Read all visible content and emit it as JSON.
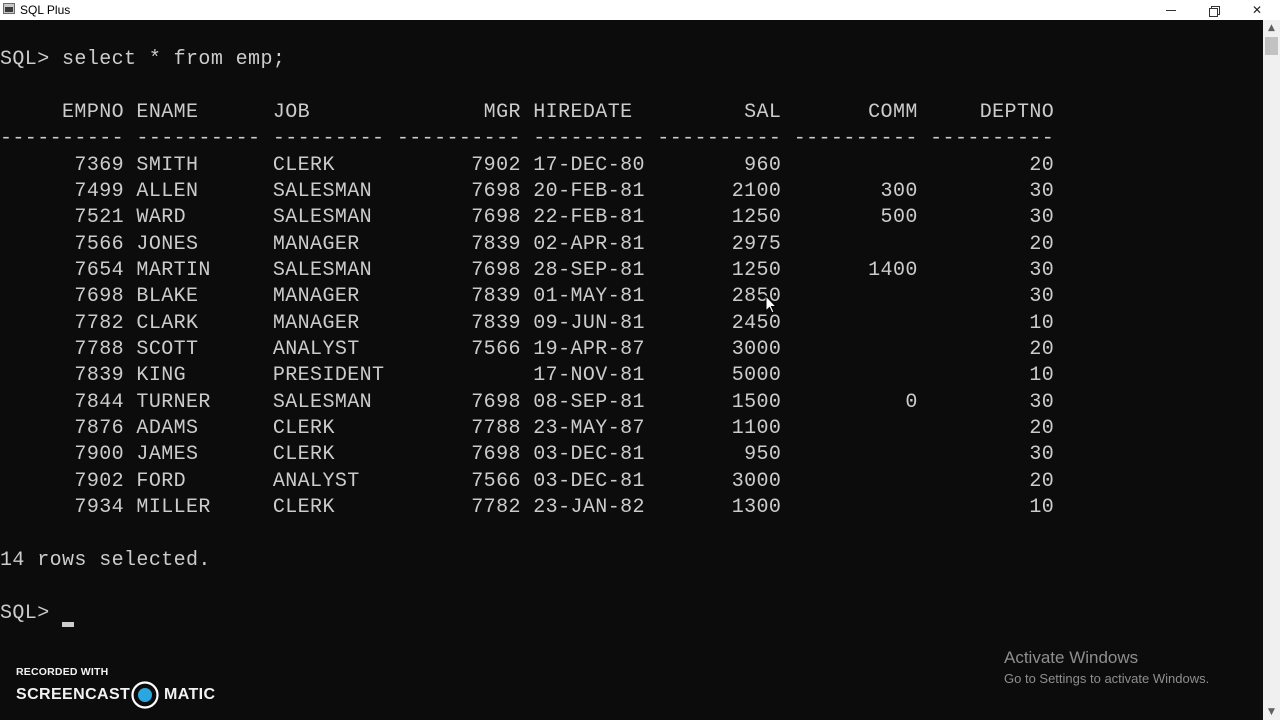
{
  "window": {
    "title": "SQL Plus",
    "icon": "sqlplus-app-icon",
    "controls": {
      "minimize_icon": "minimize-icon",
      "restore_icon": "restore-icon",
      "close_glyph": "✕"
    }
  },
  "console": {
    "lines": [
      "SQL> select * from emp;",
      "",
      "     EMPNO ENAME      JOB              MGR HIREDATE         SAL       COMM     DEPTNO",
      "---------- ---------- --------- ---------- --------- ---------- ---------- ----------",
      "      7369 SMITH      CLERK           7902 17-DEC-80        960                    20",
      "      7499 ALLEN      SALESMAN        7698 20-FEB-81       2100        300         30",
      "      7521 WARD       SALESMAN        7698 22-FEB-81       1250        500         30",
      "      7566 JONES      MANAGER         7839 02-APR-81       2975                    20",
      "      7654 MARTIN     SALESMAN        7698 28-SEP-81       1250       1400         30",
      "      7698 BLAKE      MANAGER         7839 01-MAY-81       2850                    30",
      "      7782 CLARK      MANAGER         7839 09-JUN-81       2450                    10",
      "      7788 SCOTT      ANALYST         7566 19-APR-87       3000                    20",
      "      7839 KING       PRESIDENT            17-NOV-81       5000                    10",
      "      7844 TURNER     SALESMAN        7698 08-SEP-81       1500          0         30",
      "      7876 ADAMS      CLERK           7788 23-MAY-87       1100                    20",
      "      7900 JAMES      CLERK           7698 03-DEC-81        950                    30",
      "      7902 FORD       ANALYST         7566 03-DEC-81       3000                    20",
      "      7934 MILLER     CLERK           7782 23-JAN-82       1300                    10",
      "",
      "14 rows selected.",
      "",
      "SQL> "
    ]
  },
  "watermark": {
    "activate_title": "Activate Windows",
    "activate_sub": "Go to Settings to activate Windows."
  },
  "recorder": {
    "top_text": "RECORDED WITH",
    "brand_left": "SCREENCAST",
    "brand_right": "MATIC"
  },
  "colors": {
    "console_bg": "#0c0c0c",
    "console_fg": "#cccccc",
    "titlebar_bg": "#ffffff"
  }
}
